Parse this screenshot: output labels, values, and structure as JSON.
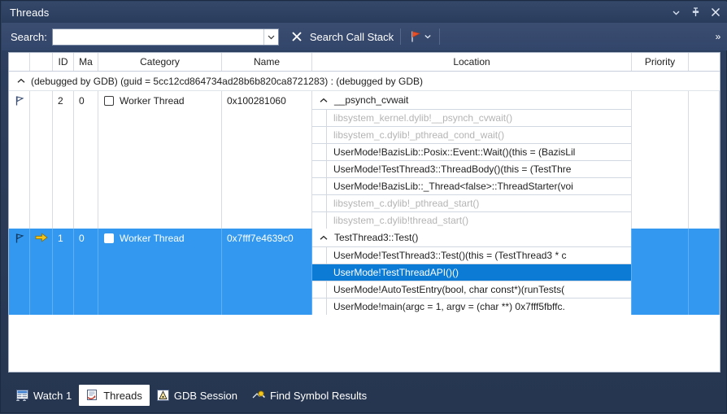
{
  "window": {
    "title": "Threads",
    "buttons": [
      {
        "name": "window-dropdown",
        "icon": "chevron-down-icon"
      },
      {
        "name": "window-pin",
        "icon": "pin-icon"
      },
      {
        "name": "window-close",
        "icon": "close-icon"
      }
    ]
  },
  "toolbar": {
    "search_label": "Search:",
    "search_value": "",
    "search_placeholder": "",
    "clear_icon": "close-x-icon",
    "search_callstack_label": "Search Call Stack",
    "flag_icon": "red-flag-icon",
    "flag_dropdown_icon": "chevron-down-icon",
    "overflow_label": "»"
  },
  "grid": {
    "columns": [
      {
        "key": "flag",
        "label": ""
      },
      {
        "key": "arrow",
        "label": ""
      },
      {
        "key": "id",
        "label": "ID"
      },
      {
        "key": "managed",
        "label": "Ma"
      },
      {
        "key": "category",
        "label": "Category"
      },
      {
        "key": "name",
        "label": "Name"
      },
      {
        "key": "location",
        "label": "Location"
      },
      {
        "key": "priority",
        "label": "Priority"
      },
      {
        "key": "tail",
        "label": ""
      }
    ],
    "group_row": {
      "caret": "chevron-up-icon",
      "label": "(debugged by GDB) (guid = 5cc12cd864734ad28b6b820ca8721283) : (debugged by GDB)"
    },
    "rows": [
      {
        "selected": false,
        "flag_icon": "flag-outline-icon",
        "current_marker": "",
        "id": "2",
        "managed": "0",
        "checkbox": "unchecked",
        "category": "Worker Thread",
        "name": "0x100281060",
        "priority": "",
        "stack_caret": "chevron-up-icon",
        "stack_top": "__psynch_cvwait",
        "stack": [
          {
            "text": "libsystem_kernel.dylib!__psynch_cvwait()",
            "style": "dim"
          },
          {
            "text": "libsystem_c.dylib!_pthread_cond_wait()",
            "style": "dim"
          },
          {
            "text": "UserMode!BazisLib::Posix::Event::Wait()(this = (BazisLil",
            "style": "normal"
          },
          {
            "text": "UserMode!TestThread3::ThreadBody()(this = (TestThre",
            "style": "normal"
          },
          {
            "text": "UserMode!BazisLib::_Thread<false>::ThreadStarter(voi",
            "style": "normal"
          },
          {
            "text": "libsystem_c.dylib!_pthread_start()",
            "style": "dim"
          },
          {
            "text": "libsystem_c.dylib!thread_start()",
            "style": "dim"
          }
        ]
      },
      {
        "selected": true,
        "flag_icon": "flag-outline-icon",
        "current_marker": "yellow-arrow-icon",
        "id": "1",
        "managed": "0",
        "checkbox": "unchecked",
        "category": "Worker Thread",
        "name": "0x7fff7e4639c0",
        "priority": "",
        "stack_caret": "chevron-up-icon",
        "stack_top": "TestThread3::Test()",
        "stack": [
          {
            "text": "UserMode!TestThread3::Test()(this = (TestThread3 * c",
            "style": "normal"
          },
          {
            "text": "UserMode!TestThreadAPI()()",
            "style": "highlight"
          },
          {
            "text": "UserMode!AutoTestEntry(bool, char const*)(runTests(",
            "style": "normal"
          },
          {
            "text": "UserMode!main(argc = 1, argv = (char **) 0x7fff5fbffc.",
            "style": "normal"
          }
        ]
      }
    ]
  },
  "tabs": [
    {
      "label": "Watch 1",
      "icon": "watch-window-icon",
      "active": false
    },
    {
      "label": "Threads",
      "icon": "threads-window-icon",
      "active": true
    },
    {
      "label": "GDB Session",
      "icon": "gdb-session-icon",
      "active": false
    },
    {
      "label": "Find Symbol Results",
      "icon": "find-symbol-icon",
      "active": false
    }
  ],
  "colors": {
    "selection_blue": "#3399f0",
    "stack_highlight_blue": "#0b7bd6",
    "window_chrome": "#32456a",
    "dim_text": "#b4b4b4",
    "flag_red": "#e8502a",
    "arrow_yellow": "#f2c41c"
  }
}
